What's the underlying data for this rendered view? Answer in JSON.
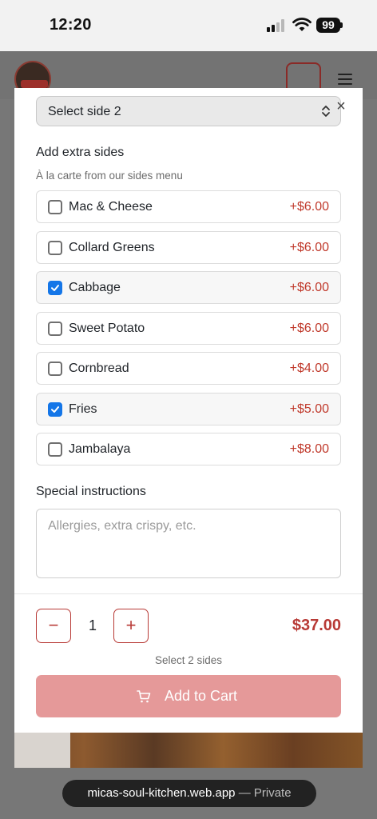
{
  "status_bar": {
    "time": "12:20",
    "battery": "99"
  },
  "modal": {
    "select_side": {
      "value": "Select side 2"
    },
    "extras": {
      "title": "Add extra sides",
      "subtitle": "À la carte from our sides menu",
      "items": [
        {
          "label": "Mac & Cheese",
          "price": "+$6.00",
          "checked": false
        },
        {
          "label": "Collard Greens",
          "price": "+$6.00",
          "checked": false
        },
        {
          "label": "Cabbage",
          "price": "+$6.00",
          "checked": true
        },
        {
          "label": "Sweet Potato",
          "price": "+$6.00",
          "checked": false
        },
        {
          "label": "Cornbread",
          "price": "+$4.00",
          "checked": false
        },
        {
          "label": "Fries",
          "price": "+$5.00",
          "checked": true
        },
        {
          "label": "Jambalaya",
          "price": "+$8.00",
          "checked": false
        }
      ]
    },
    "instructions": {
      "title": "Special instructions",
      "placeholder": "Allergies, extra crispy, etc."
    },
    "footer": {
      "decrement": "−",
      "quantity": "1",
      "increment": "+",
      "total": "$37.00",
      "hint": "Select 2 sides",
      "add_to_cart": "Add to Cart"
    }
  },
  "browser": {
    "host": "micas-soul-kitchen.web.app",
    "separator": " — ",
    "mode": "Private"
  },
  "colors": {
    "accent": "#b83a36",
    "checkbox": "#1476e8",
    "price": "#c0392b",
    "cta_disabled": "#e59999"
  }
}
